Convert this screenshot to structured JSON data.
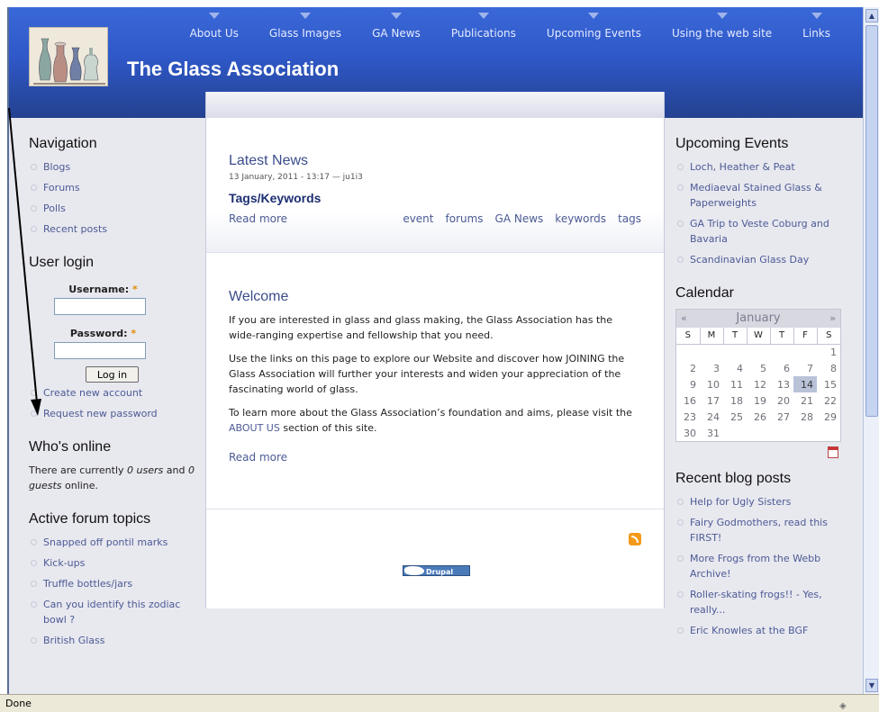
{
  "site": {
    "name": "The Glass Association"
  },
  "primary_nav": [
    "About Us",
    "Glass Images",
    "GA News",
    "Publications",
    "Upcoming Events",
    "Using the web site",
    "Links"
  ],
  "left_sidebar": {
    "navigation": {
      "title": "Navigation",
      "items": [
        "Blogs",
        "Forums",
        "Polls",
        "Recent posts"
      ]
    },
    "user_login": {
      "title": "User login",
      "username_label": "Username:",
      "password_label": "Password:",
      "required_mark": "*",
      "login_button": "Log in",
      "links": [
        "Create new account",
        "Request new password"
      ]
    },
    "whos_online": {
      "title": "Who's online",
      "text_pre": "There are currently ",
      "users": "0 users",
      "text_mid": " and ",
      "guests": "0 guests",
      "text_post": " online."
    },
    "forum_topics": {
      "title": "Active forum topics",
      "items": [
        "Snapped off pontil marks",
        "Kick-ups",
        "Truffle bottles/jars",
        "Can you identify this zodiac bowl ?",
        "British Glass"
      ]
    }
  },
  "main": {
    "news": {
      "title": "Latest News",
      "submitted": "13 January, 2011 - 13:17 — ju1i3",
      "subtitle": "Tags/Keywords",
      "read_more": "Read more",
      "tags": [
        "event",
        "forums",
        "GA News",
        "keywords",
        "tags"
      ]
    },
    "welcome": {
      "title": "Welcome",
      "p1": "If you are interested in glass and glass making, the Glass Association has the wide-ranging expertise and fellowship that you need.",
      "p2": "Use the links on this page to explore our Website and discover how JOINING the Glass Association will further your interests and widen your appreciation of the fascinating world of glass.",
      "p3_pre": "To learn more about the Glass Association’s foundation and aims, please visit the ",
      "p3_link": "ABOUT US",
      "p3_post": " section of this site.",
      "read_more": "Read more"
    },
    "drupal_badge": "Drupal"
  },
  "right_sidebar": {
    "upcoming_events": {
      "title": "Upcoming Events",
      "items": [
        "Loch, Heather & Peat",
        "Mediaeval Stained Glass & Paperweights",
        "GA Trip to Veste Coburg and Bavaria",
        "Scandinavian Glass Day"
      ]
    },
    "calendar": {
      "title": "Calendar",
      "month": "January",
      "prev": "«",
      "next": "»",
      "weekdays": [
        "S",
        "M",
        "T",
        "W",
        "T",
        "F",
        "S"
      ],
      "weeks": [
        [
          "",
          "",
          "",
          "",
          "",
          "",
          "1"
        ],
        [
          "2",
          "3",
          "4",
          "5",
          "6",
          "7",
          "8"
        ],
        [
          "9",
          "10",
          "11",
          "12",
          "13",
          "14",
          "15"
        ],
        [
          "16",
          "17",
          "18",
          "19",
          "20",
          "21",
          "22"
        ],
        [
          "23",
          "24",
          "25",
          "26",
          "27",
          "28",
          "29"
        ],
        [
          "30",
          "31",
          "",
          "",
          "",
          "",
          ""
        ]
      ],
      "today": "14"
    },
    "recent_blog_posts": {
      "title": "Recent blog posts",
      "items": [
        "Help for Ugly Sisters",
        "Fairy Godmothers, read this FIRST!",
        "More Frogs from the Webb Archive!",
        "Roller-skating frogs!! - Yes, really...",
        "Eric Knowles at the BGF"
      ]
    }
  },
  "browser": {
    "status": "Done"
  }
}
